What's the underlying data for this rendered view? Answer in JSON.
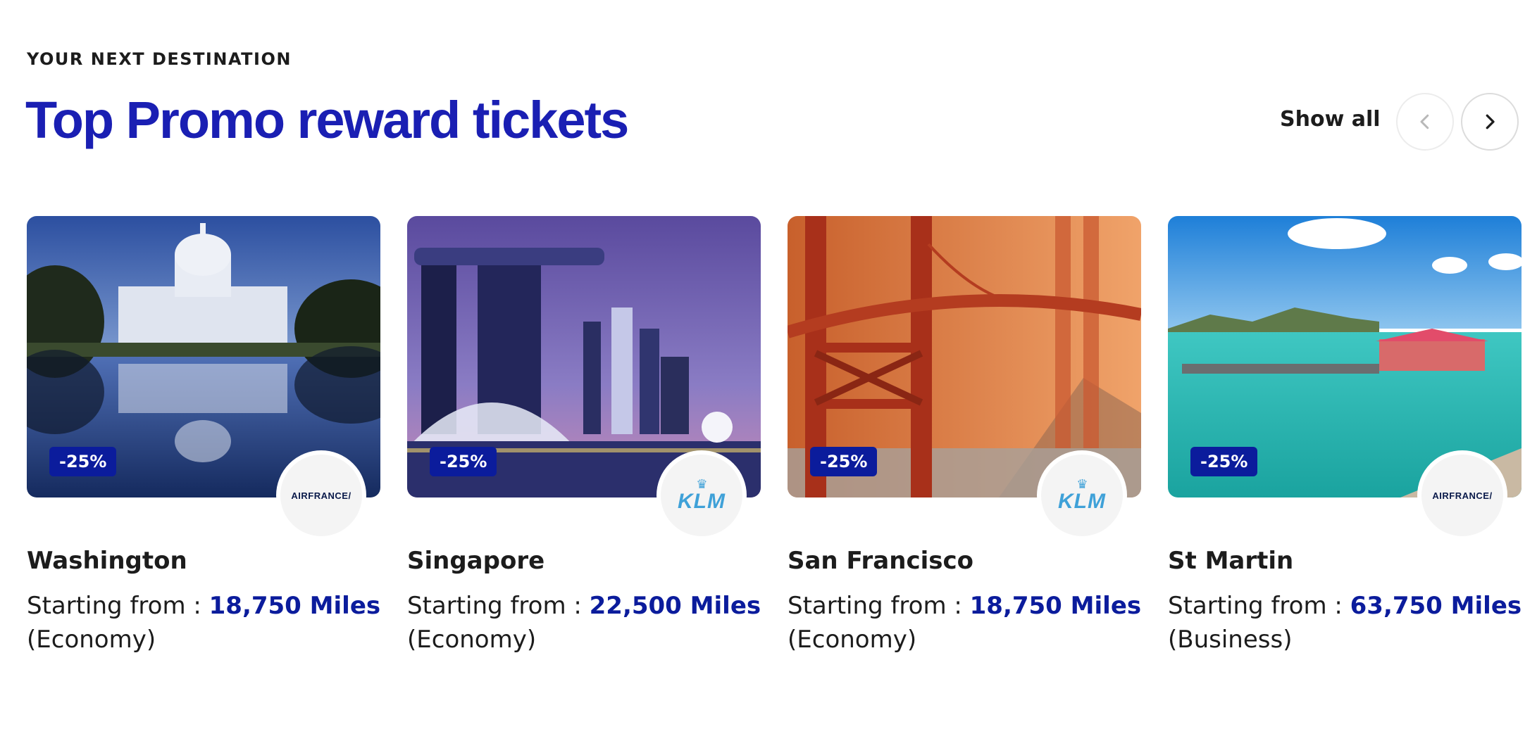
{
  "section": {
    "eyebrow": "YOUR NEXT DESTINATION",
    "title": "Top Promo reward tickets",
    "show_all": "Show all"
  },
  "colors": {
    "brand_blue": "#1a1fb3",
    "badge_bg": "#0b1c9c",
    "miles_color": "#0b1c9c"
  },
  "cards": [
    {
      "badge": "-25%",
      "airline": "AIRFRANCE",
      "airline_logo": "airfrance-logo",
      "city": "Washington",
      "price_prefix": "Starting from :",
      "miles": "18,750 Miles",
      "cabin": "(Economy)"
    },
    {
      "badge": "-25%",
      "airline": "KLM",
      "airline_logo": "klm-logo",
      "city": "Singapore",
      "price_prefix": "Starting from :",
      "miles": "22,500 Miles",
      "cabin": "(Economy)"
    },
    {
      "badge": "-25%",
      "airline": "KLM",
      "airline_logo": "klm-logo",
      "city": "San Francisco",
      "price_prefix": "Starting from :",
      "miles": "18,750 Miles",
      "cabin": "(Economy)"
    },
    {
      "badge": "-25%",
      "airline": "AIRFRANCE",
      "airline_logo": "airfrance-logo",
      "city": "St Martin",
      "price_prefix": "Starting from :",
      "miles": "63,750 Miles",
      "cabin": "(Business)"
    }
  ],
  "icons": {
    "prev": "chevron-left-icon",
    "next": "chevron-right-icon"
  }
}
